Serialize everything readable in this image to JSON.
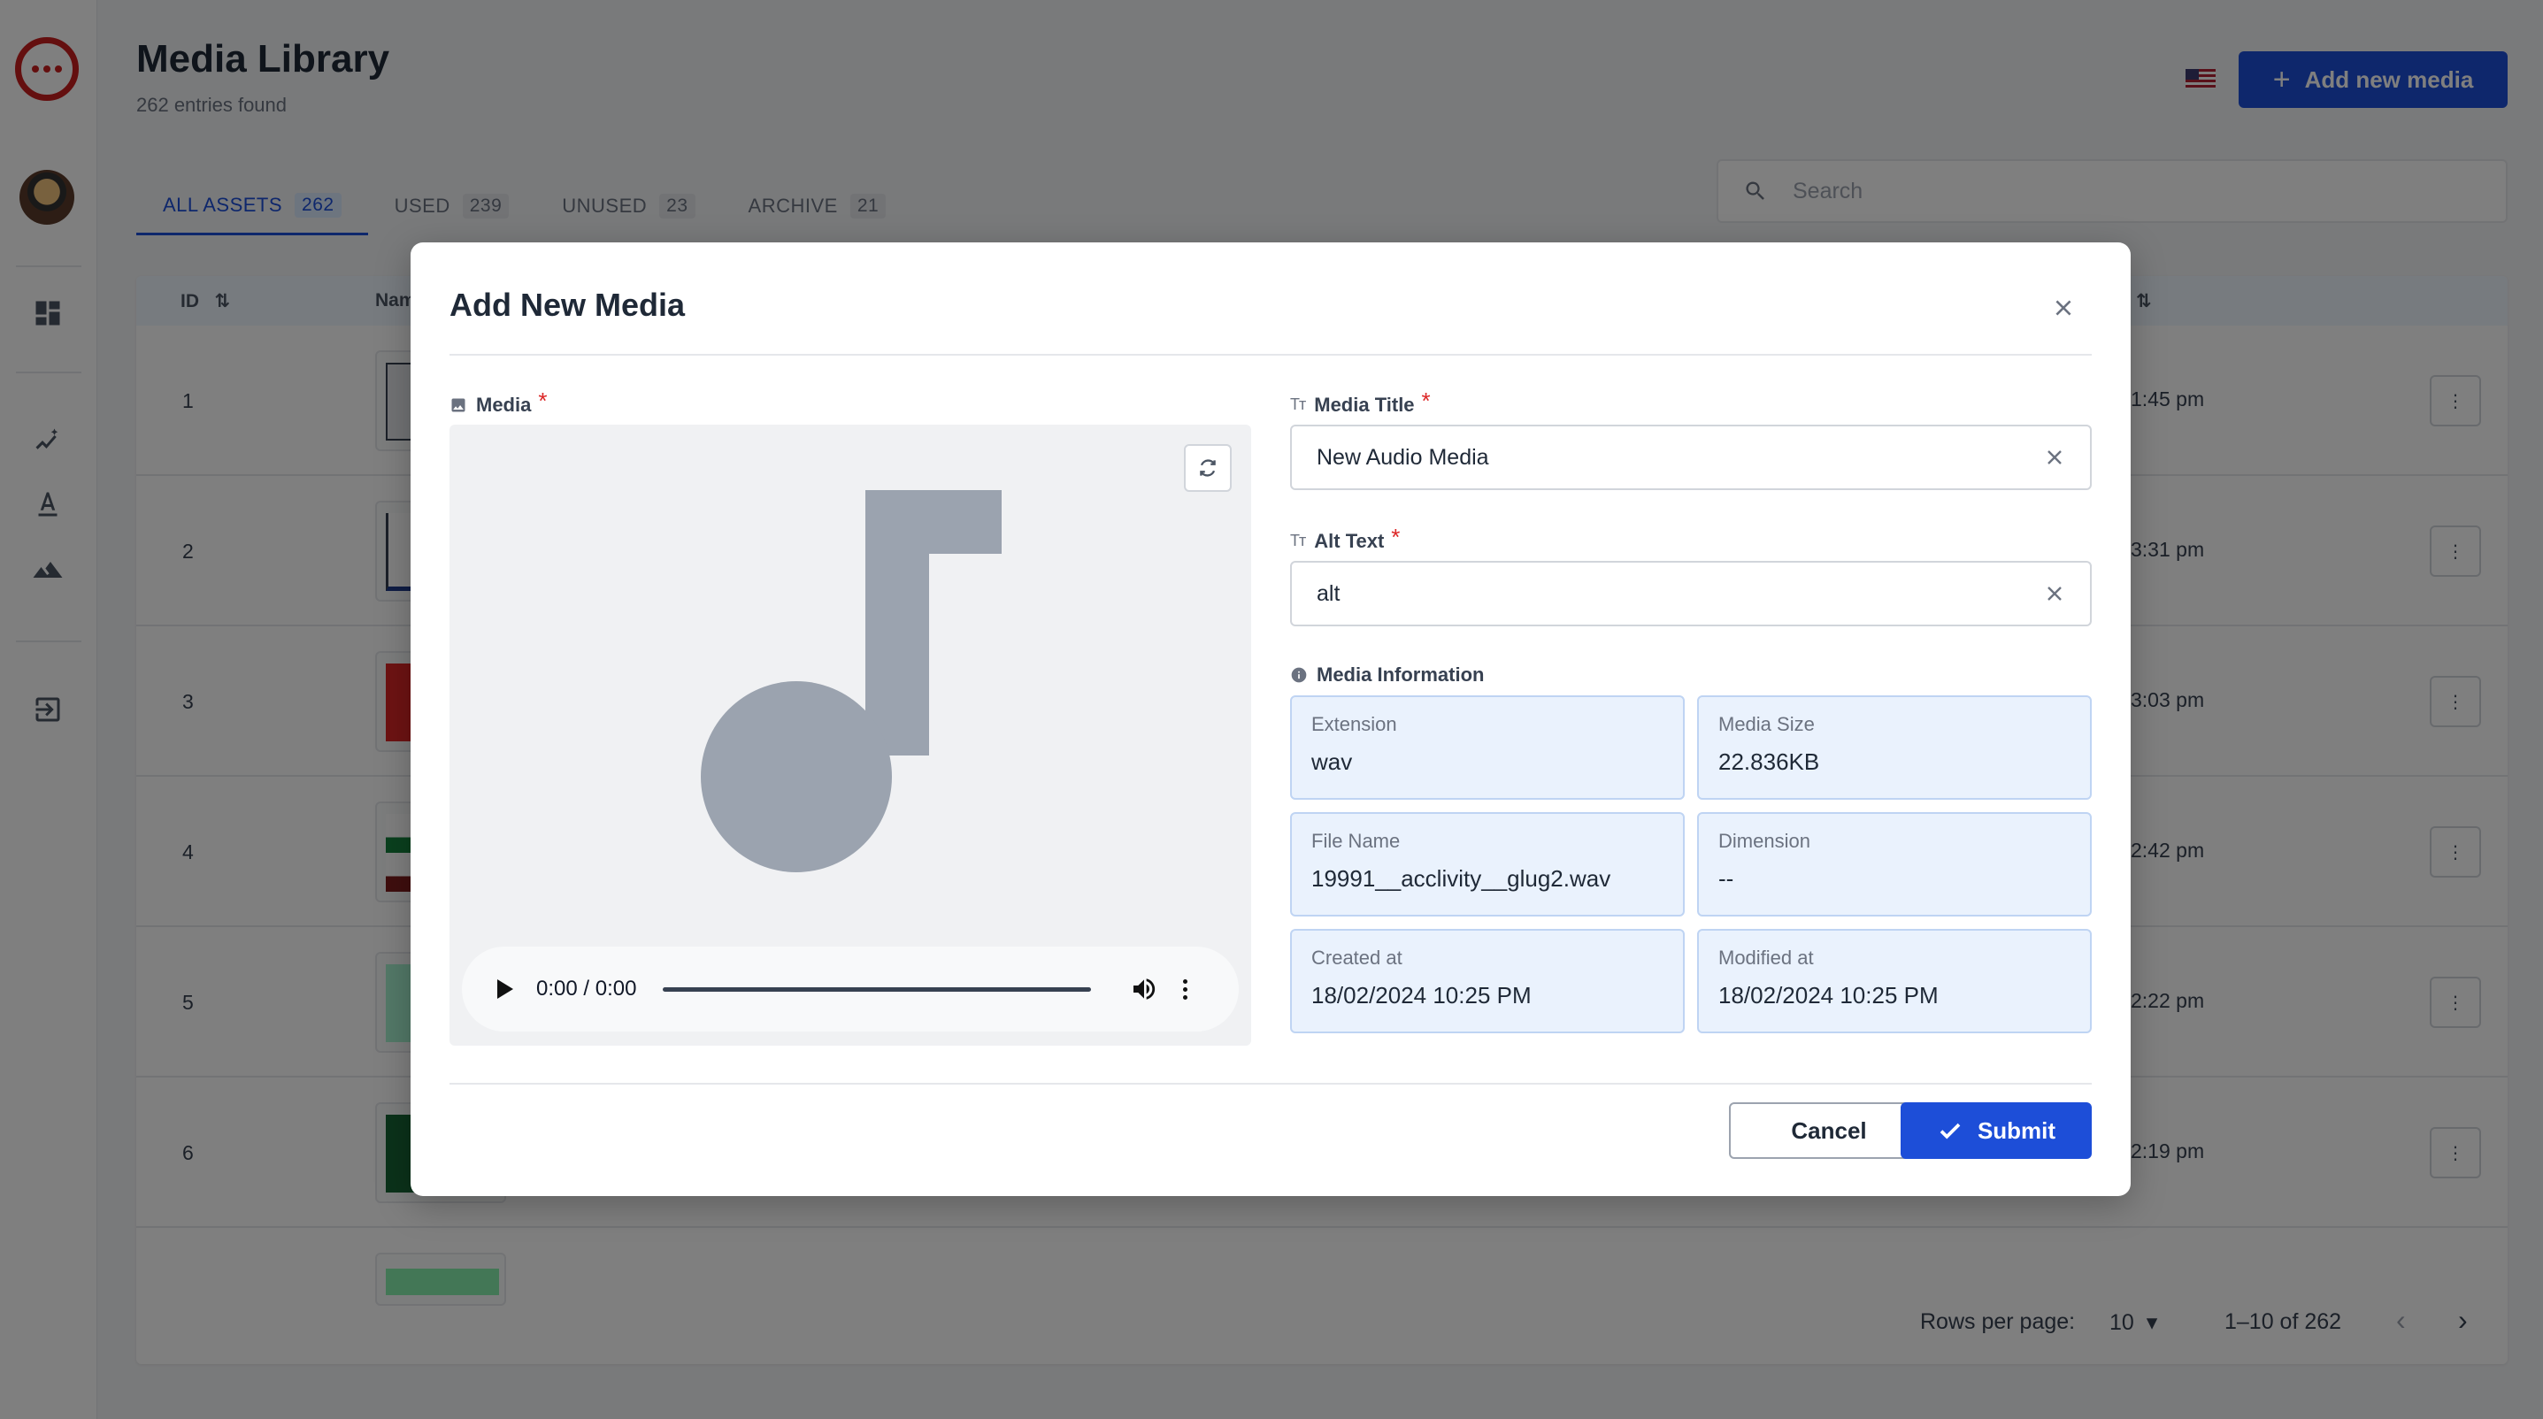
{
  "header": {
    "title": "Media Library",
    "subtitle": "262 entries found",
    "add_button_label": "Add new media"
  },
  "tabs": [
    {
      "label": "ALL ASSETS",
      "count": "262"
    },
    {
      "label": "USED",
      "count": "239"
    },
    {
      "label": "UNUSED",
      "count": "23"
    },
    {
      "label": "ARCHIVE",
      "count": "21"
    }
  ],
  "search": {
    "placeholder": "Search"
  },
  "table": {
    "columns": {
      "id": "ID",
      "name": "Nam"
    },
    "rows": [
      {
        "id": "1",
        "time": "1:45 pm"
      },
      {
        "id": "2",
        "time": "3:31 pm"
      },
      {
        "id": "3",
        "time": "3:03 pm"
      },
      {
        "id": "4",
        "time": "2:42 pm"
      },
      {
        "id": "5",
        "time": "2:22 pm"
      },
      {
        "id": "6",
        "time": "2:19 pm"
      }
    ]
  },
  "pagination": {
    "rows_per_page_label": "Rows per page:",
    "rows_per_page_value": "10",
    "range": "1–10 of 262"
  },
  "modal": {
    "title": "Add New Media",
    "media_label": "Media",
    "media_title_label": "Media Title",
    "media_title_value": "New Audio Media",
    "alt_text_label": "Alt Text",
    "alt_text_value": "alt",
    "info_label": "Media Information",
    "audio_time": "0:00 / 0:00",
    "info": {
      "extension": {
        "label": "Extension",
        "value": "wav"
      },
      "size": {
        "label": "Media Size",
        "value": "22.836KB"
      },
      "file_name": {
        "label": "File Name",
        "value": "19991__acclivity__glug2.wav"
      },
      "dimension": {
        "label": "Dimension",
        "value": "--"
      },
      "created": {
        "label": "Created at",
        "value": "18/02/2024 10:25 PM"
      },
      "modified": {
        "label": "Modified at",
        "value": "18/02/2024 10:25 PM"
      }
    },
    "cancel_label": "Cancel",
    "submit_label": "Submit"
  },
  "colors": {
    "primary": "#1d4ed8",
    "danger": "#dc2626",
    "brand": "#c81e1e",
    "info_card_bg": "#eaf2fd"
  }
}
